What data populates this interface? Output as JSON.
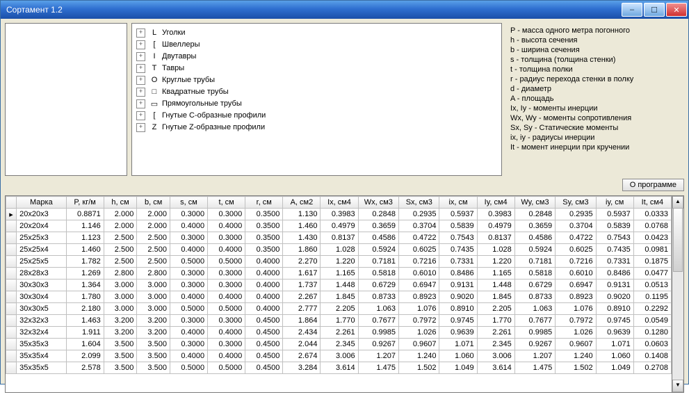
{
  "window": {
    "title": "Сортамент 1.2"
  },
  "tree": {
    "items": [
      {
        "icon": "L",
        "label": "Уголки"
      },
      {
        "icon": "[",
        "label": "Швеллеры"
      },
      {
        "icon": "I",
        "label": "Двутавры"
      },
      {
        "icon": "T",
        "label": "Тавры"
      },
      {
        "icon": "O",
        "label": "Круглые трубы"
      },
      {
        "icon": "□",
        "label": "Квадратные трубы"
      },
      {
        "icon": "▭",
        "label": "Прямоугольные трубы"
      },
      {
        "icon": "[",
        "label": "Гнутые С-образные профили"
      },
      {
        "icon": "Z",
        "label": "Гнутые Z-образные профили"
      }
    ]
  },
  "legend": [
    "P - масса одного метра погонного",
    "h - высота сечения",
    "b - ширина сечения",
    "s - толщина (толщина стенки)",
    "t - толщина полки",
    "r - радиус перехода стенки в полку",
    "d - диаметр",
    "A - площадь",
    "Ix, Iy - моменты инерции",
    "Wx, Wy - моменты сопротивления",
    "Sx, Sy - Статические моменты",
    "ix, iy - радиусы инерции",
    "It - момент инерции при кручении"
  ],
  "buttons": {
    "about": "О программе"
  },
  "grid": {
    "columns": [
      "Марка",
      "P, кг/м",
      "h, см",
      "b, см",
      "s, см",
      "t, см",
      "r, см",
      "A, см2",
      "Ix, см4",
      "Wx, см3",
      "Sx, см3",
      "ix, см",
      "Iy, см4",
      "Wy, см3",
      "Sy, см3",
      "iy, см",
      "It, см4"
    ],
    "rows": [
      [
        "20x20x3",
        "0.8871",
        "2.000",
        "2.000",
        "0.3000",
        "0.3000",
        "0.3500",
        "1.130",
        "0.3983",
        "0.2848",
        "0.2935",
        "0.5937",
        "0.3983",
        "0.2848",
        "0.2935",
        "0.5937",
        "0.0333"
      ],
      [
        "20x20x4",
        "1.146",
        "2.000",
        "2.000",
        "0.4000",
        "0.4000",
        "0.3500",
        "1.460",
        "0.4979",
        "0.3659",
        "0.3704",
        "0.5839",
        "0.4979",
        "0.3659",
        "0.3704",
        "0.5839",
        "0.0768"
      ],
      [
        "25x25x3",
        "1.123",
        "2.500",
        "2.500",
        "0.3000",
        "0.3000",
        "0.3500",
        "1.430",
        "0.8137",
        "0.4586",
        "0.4722",
        "0.7543",
        "0.8137",
        "0.4586",
        "0.4722",
        "0.7543",
        "0.0423"
      ],
      [
        "25x25x4",
        "1.460",
        "2.500",
        "2.500",
        "0.4000",
        "0.4000",
        "0.3500",
        "1.860",
        "1.028",
        "0.5924",
        "0.6025",
        "0.7435",
        "1.028",
        "0.5924",
        "0.6025",
        "0.7435",
        "0.0981"
      ],
      [
        "25x25x5",
        "1.782",
        "2.500",
        "2.500",
        "0.5000",
        "0.5000",
        "0.4000",
        "2.270",
        "1.220",
        "0.7181",
        "0.7216",
        "0.7331",
        "1.220",
        "0.7181",
        "0.7216",
        "0.7331",
        "0.1875"
      ],
      [
        "28x28x3",
        "1.269",
        "2.800",
        "2.800",
        "0.3000",
        "0.3000",
        "0.4000",
        "1.617",
        "1.165",
        "0.5818",
        "0.6010",
        "0.8486",
        "1.165",
        "0.5818",
        "0.6010",
        "0.8486",
        "0.0477"
      ],
      [
        "30x30x3",
        "1.364",
        "3.000",
        "3.000",
        "0.3000",
        "0.3000",
        "0.4000",
        "1.737",
        "1.448",
        "0.6729",
        "0.6947",
        "0.9131",
        "1.448",
        "0.6729",
        "0.6947",
        "0.9131",
        "0.0513"
      ],
      [
        "30x30x4",
        "1.780",
        "3.000",
        "3.000",
        "0.4000",
        "0.4000",
        "0.4000",
        "2.267",
        "1.845",
        "0.8733",
        "0.8923",
        "0.9020",
        "1.845",
        "0.8733",
        "0.8923",
        "0.9020",
        "0.1195"
      ],
      [
        "30x30x5",
        "2.180",
        "3.000",
        "3.000",
        "0.5000",
        "0.5000",
        "0.4000",
        "2.777",
        "2.205",
        "1.063",
        "1.076",
        "0.8910",
        "2.205",
        "1.063",
        "1.076",
        "0.8910",
        "0.2292"
      ],
      [
        "32x32x3",
        "1.463",
        "3.200",
        "3.200",
        "0.3000",
        "0.3000",
        "0.4500",
        "1.864",
        "1.770",
        "0.7677",
        "0.7972",
        "0.9745",
        "1.770",
        "0.7677",
        "0.7972",
        "0.9745",
        "0.0549"
      ],
      [
        "32x32x4",
        "1.911",
        "3.200",
        "3.200",
        "0.4000",
        "0.4000",
        "0.4500",
        "2.434",
        "2.261",
        "0.9985",
        "1.026",
        "0.9639",
        "2.261",
        "0.9985",
        "1.026",
        "0.9639",
        "0.1280"
      ],
      [
        "35x35x3",
        "1.604",
        "3.500",
        "3.500",
        "0.3000",
        "0.3000",
        "0.4500",
        "2.044",
        "2.345",
        "0.9267",
        "0.9607",
        "1.071",
        "2.345",
        "0.9267",
        "0.9607",
        "1.071",
        "0.0603"
      ],
      [
        "35x35x4",
        "2.099",
        "3.500",
        "3.500",
        "0.4000",
        "0.4000",
        "0.4500",
        "2.674",
        "3.006",
        "1.207",
        "1.240",
        "1.060",
        "3.006",
        "1.207",
        "1.240",
        "1.060",
        "0.1408"
      ],
      [
        "35x35x5",
        "2.578",
        "3.500",
        "3.500",
        "0.5000",
        "0.5000",
        "0.4500",
        "3.284",
        "3.614",
        "1.475",
        "1.502",
        "1.049",
        "3.614",
        "1.475",
        "1.502",
        "1.049",
        "0.2708"
      ]
    ]
  },
  "chart_data": {
    "type": "table",
    "title": "Сортамент — параметры профилей",
    "columns": [
      "Марка",
      "P, кг/м",
      "h, см",
      "b, см",
      "s, см",
      "t, см",
      "r, см",
      "A, см2",
      "Ix, см4",
      "Wx, см3",
      "Sx, см3",
      "ix, см",
      "Iy, см4",
      "Wy, см3",
      "Sy, см3",
      "iy, см",
      "It, см4"
    ],
    "rows": [
      [
        "20x20x3",
        0.8871,
        2.0,
        2.0,
        0.3,
        0.3,
        0.35,
        1.13,
        0.3983,
        0.2848,
        0.2935,
        0.5937,
        0.3983,
        0.2848,
        0.2935,
        0.5937,
        0.0333
      ],
      [
        "20x20x4",
        1.146,
        2.0,
        2.0,
        0.4,
        0.4,
        0.35,
        1.46,
        0.4979,
        0.3659,
        0.3704,
        0.5839,
        0.4979,
        0.3659,
        0.3704,
        0.5839,
        0.0768
      ],
      [
        "25x25x3",
        1.123,
        2.5,
        2.5,
        0.3,
        0.3,
        0.35,
        1.43,
        0.8137,
        0.4586,
        0.4722,
        0.7543,
        0.8137,
        0.4586,
        0.4722,
        0.7543,
        0.0423
      ],
      [
        "25x25x4",
        1.46,
        2.5,
        2.5,
        0.4,
        0.4,
        0.35,
        1.86,
        1.028,
        0.5924,
        0.6025,
        0.7435,
        1.028,
        0.5924,
        0.6025,
        0.7435,
        0.0981
      ],
      [
        "25x25x5",
        1.782,
        2.5,
        2.5,
        0.5,
        0.5,
        0.4,
        2.27,
        1.22,
        0.7181,
        0.7216,
        0.7331,
        1.22,
        0.7181,
        0.7216,
        0.7331,
        0.1875
      ],
      [
        "28x28x3",
        1.269,
        2.8,
        2.8,
        0.3,
        0.3,
        0.4,
        1.617,
        1.165,
        0.5818,
        0.601,
        0.8486,
        1.165,
        0.5818,
        0.601,
        0.8486,
        0.0477
      ],
      [
        "30x30x3",
        1.364,
        3.0,
        3.0,
        0.3,
        0.3,
        0.4,
        1.737,
        1.448,
        0.6729,
        0.6947,
        0.9131,
        1.448,
        0.6729,
        0.6947,
        0.9131,
        0.0513
      ],
      [
        "30x30x4",
        1.78,
        3.0,
        3.0,
        0.4,
        0.4,
        0.4,
        2.267,
        1.845,
        0.8733,
        0.8923,
        0.902,
        1.845,
        0.8733,
        0.8923,
        0.902,
        0.1195
      ],
      [
        "30x30x5",
        2.18,
        3.0,
        3.0,
        0.5,
        0.5,
        0.4,
        2.777,
        2.205,
        1.063,
        1.076,
        0.891,
        2.205,
        1.063,
        1.076,
        0.891,
        0.2292
      ],
      [
        "32x32x3",
        1.463,
        3.2,
        3.2,
        0.3,
        0.3,
        0.45,
        1.864,
        1.77,
        0.7677,
        0.7972,
        0.9745,
        1.77,
        0.7677,
        0.7972,
        0.9745,
        0.0549
      ],
      [
        "32x32x4",
        1.911,
        3.2,
        3.2,
        0.4,
        0.4,
        0.45,
        2.434,
        2.261,
        0.9985,
        1.026,
        0.9639,
        2.261,
        0.9985,
        1.026,
        0.9639,
        0.128
      ],
      [
        "35x35x3",
        1.604,
        3.5,
        3.5,
        0.3,
        0.3,
        0.45,
        2.044,
        2.345,
        0.9267,
        0.9607,
        1.071,
        2.345,
        0.9267,
        0.9607,
        1.071,
        0.0603
      ],
      [
        "35x35x4",
        2.099,
        3.5,
        3.5,
        0.4,
        0.4,
        0.45,
        2.674,
        3.006,
        1.207,
        1.24,
        1.06,
        3.006,
        1.207,
        1.24,
        1.06,
        0.1408
      ],
      [
        "35x35x5",
        2.578,
        3.5,
        3.5,
        0.5,
        0.5,
        0.45,
        3.284,
        3.614,
        1.475,
        1.502,
        1.049,
        3.614,
        1.475,
        1.502,
        1.049,
        0.2708
      ]
    ]
  }
}
